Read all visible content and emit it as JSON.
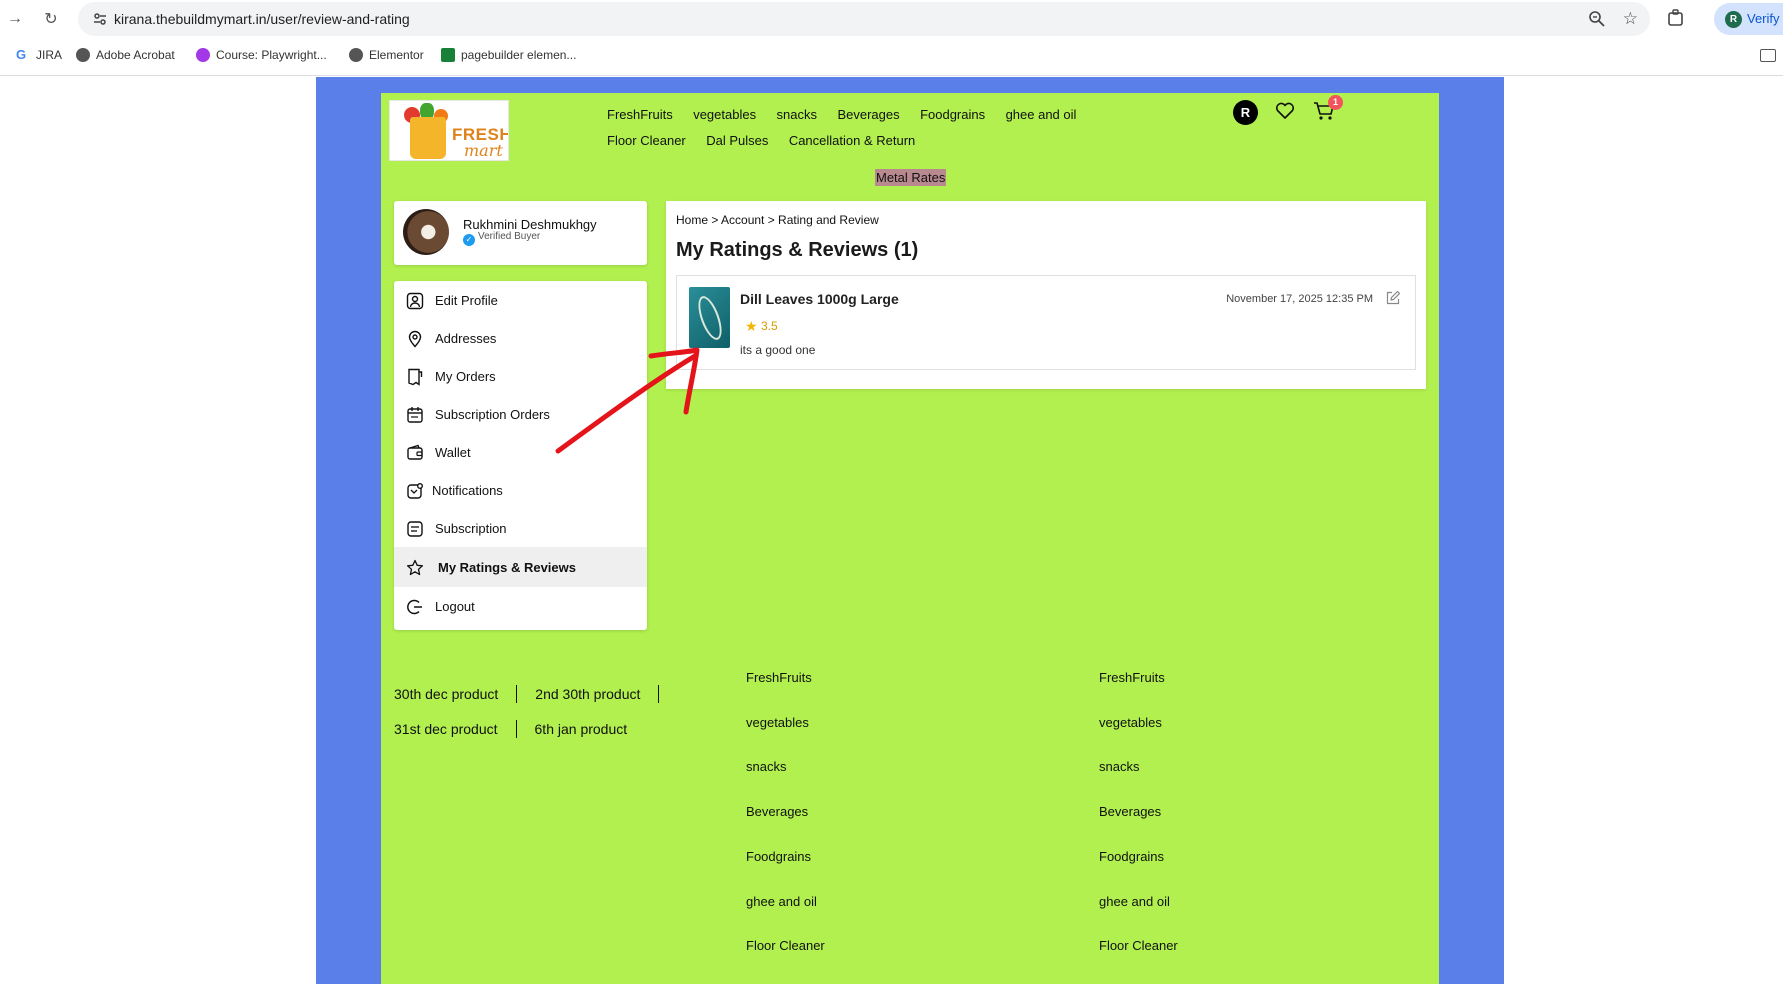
{
  "browser": {
    "url": "kirana.thebuildmymart.in/user/review-and-rating",
    "profile_label": "Verify",
    "profile_initial": "R",
    "bookmarks": [
      {
        "label": "JIRA",
        "icon": "google-icon"
      },
      {
        "label": "Adobe Acrobat",
        "icon": "globe-icon"
      },
      {
        "label": "Course: Playwright...",
        "icon": "course-icon"
      },
      {
        "label": "Elementor",
        "icon": "globe-icon"
      },
      {
        "label": "pagebuilder elemen...",
        "icon": "sheets-icon"
      }
    ]
  },
  "header": {
    "logo_line1": "FRESH",
    "logo_line2": "mart",
    "nav": [
      "FreshFruits",
      "vegetables",
      "snacks",
      "Beverages",
      "Foodgrains",
      "ghee and oil",
      "Floor Cleaner",
      "Dal Pulses",
      "Cancellation & Return"
    ],
    "user_initial": "R",
    "cart_count": "1",
    "metal_rates": "Metal Rates"
  },
  "profile": {
    "name": "Rukhmini Deshmukhgy",
    "verified_label": "Verified Buyer"
  },
  "menu": [
    {
      "label": "Edit Profile",
      "icon": "user-icon"
    },
    {
      "label": "Addresses",
      "icon": "location-pin-icon"
    },
    {
      "label": "My Orders",
      "icon": "orders-icon"
    },
    {
      "label": "Subscription Orders",
      "icon": "calendar-icon"
    },
    {
      "label": "Wallet",
      "icon": "wallet-icon"
    },
    {
      "label": "Notifications",
      "icon": "notification-icon"
    },
    {
      "label": "Subscription",
      "icon": "subscription-icon"
    },
    {
      "label": "My Ratings & Reviews",
      "icon": "star-outline-icon",
      "active": true
    },
    {
      "label": "Logout",
      "icon": "logout-icon"
    }
  ],
  "content": {
    "breadcrumb": "Home > Account > Rating and Review",
    "title": "My Ratings & Reviews (1)",
    "reviews": [
      {
        "product": "Dill Leaves 1000g Large",
        "rating": "3.5",
        "text": "its a good one",
        "date": "November 17, 2025 12:35 PM"
      }
    ]
  },
  "footer": {
    "quick_links_row1": [
      "30th dec product",
      "2nd 30th product"
    ],
    "quick_links_row2": [
      "31st dec product",
      "6th jan product"
    ],
    "col1": [
      "FreshFruits",
      "vegetables",
      "snacks",
      "Beverages",
      "Foodgrains",
      "ghee and oil",
      "Floor Cleaner"
    ],
    "col2": [
      "FreshFruits",
      "vegetables",
      "snacks",
      "Beverages",
      "Foodgrains",
      "ghee and oil",
      "Floor Cleaner"
    ]
  },
  "colors": {
    "page_bg": "#5b7fe8",
    "content_bg": "#b1f04f",
    "annotation_arrow": "#e4141b"
  }
}
